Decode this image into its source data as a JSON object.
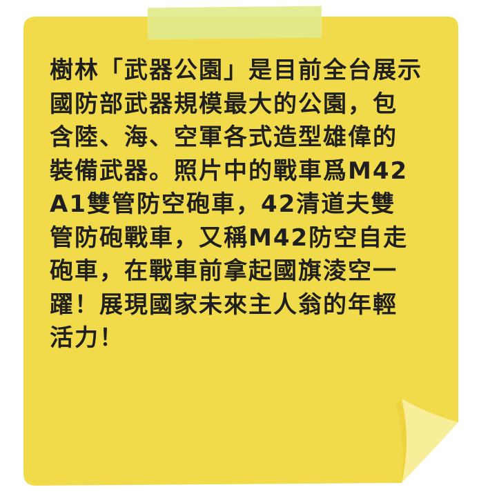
{
  "note": {
    "lines": [
      "樹林「武器公園」是目前全台展示",
      "國防部武器規模最大的公園，包",
      "含陸、海、空軍各式造型雄偉的",
      "裝備武器。照片中的戰車爲M42",
      "A1雙管防空砲車，42清道夫雙",
      "管防砲戰車，又稱M42防空自走",
      "砲車，在戰車前拿起國旗淩空一",
      "躍！展現國家未來主人翁的年輕",
      "活力！"
    ],
    "colors": {
      "paper": "#f2db4a",
      "curl_shadow": "#eed33e",
      "curl_flap": "#f8ee9a",
      "tape": "#e3ea8d",
      "text": "#1f1f1f"
    }
  }
}
